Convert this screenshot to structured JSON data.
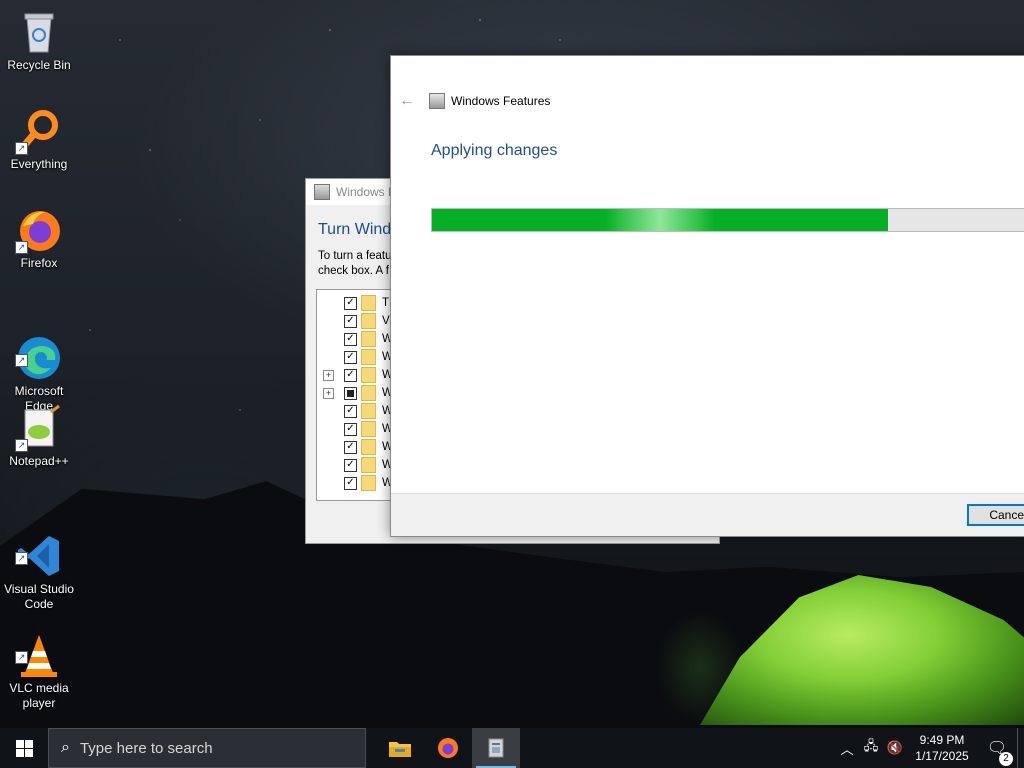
{
  "desktop": {
    "icons": [
      {
        "label": "Recycle Bin",
        "icon": "recycle-bin-icon"
      },
      {
        "label": "Everything",
        "icon": "everything-search-icon"
      },
      {
        "label": "Firefox",
        "icon": "firefox-icon"
      },
      {
        "label": "Microsoft\nEdge",
        "icon": "edge-icon"
      },
      {
        "label": "Notepad++",
        "icon": "notepadpp-icon"
      },
      {
        "label": "Visual Studio\nCode",
        "icon": "vscode-icon"
      },
      {
        "label": "VLC media\nplayer",
        "icon": "vlc-icon"
      }
    ]
  },
  "back_window": {
    "title": "Windows F",
    "heading": "Turn Wind",
    "description": "To turn a featu\ncheck box. A f",
    "features": [
      {
        "label": "TFT",
        "expandable": false,
        "state": "checked"
      },
      {
        "label": "Virt",
        "expandable": false,
        "state": "checked"
      },
      {
        "label": "Win",
        "expandable": false,
        "state": "checked"
      },
      {
        "label": "Win",
        "expandable": false,
        "state": "checked"
      },
      {
        "label": "Win",
        "expandable": true,
        "state": "checked"
      },
      {
        "label": "Win",
        "expandable": true,
        "state": "partial"
      },
      {
        "label": "Win",
        "expandable": false,
        "state": "checked"
      },
      {
        "label": "Win",
        "expandable": false,
        "state": "checked"
      },
      {
        "label": "Win",
        "expandable": false,
        "state": "checked"
      },
      {
        "label": "Win",
        "expandable": false,
        "state": "checked"
      },
      {
        "label": "Wo",
        "expandable": false,
        "state": "checked"
      }
    ]
  },
  "front_window": {
    "title": "Windows Features",
    "status": "Applying changes",
    "progress": 0.76,
    "cancel_label": "Cancel",
    "progress_color": "#06b025"
  },
  "taskbar": {
    "search_placeholder": "Type here to search",
    "apps": [
      "file-explorer-icon",
      "firefox-icon",
      "windows-features-icon"
    ],
    "time": "9:49 PM",
    "date": "1/17/2025",
    "notification_count": "2"
  }
}
